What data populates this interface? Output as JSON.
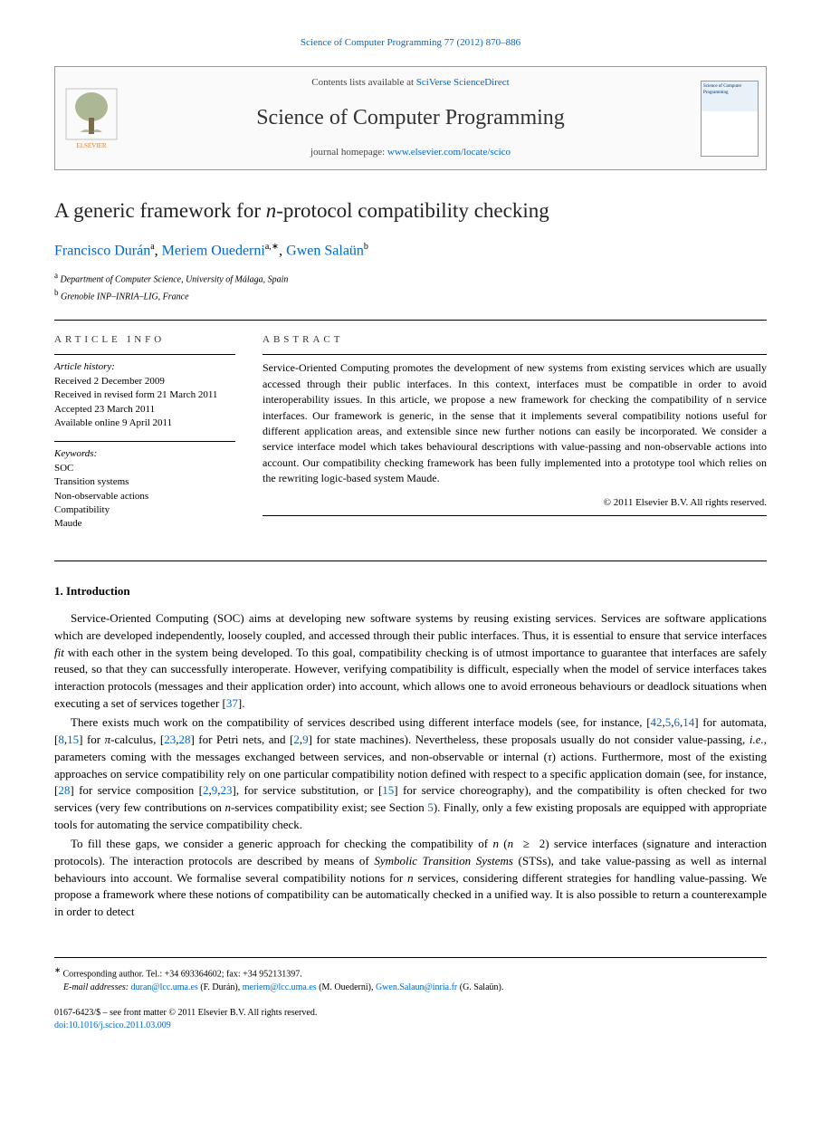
{
  "citation": "Science of Computer Programming 77 (2012) 870–886",
  "contents_text": "Contents lists available at ",
  "contents_link": "SciVerse ScienceDirect",
  "journal_name": "Science of Computer Programming",
  "homepage_text": "journal homepage: ",
  "homepage_link": "www.elsevier.com/locate/scico",
  "cover_text": "Science of Computer Programming",
  "title_plain": "A generic framework for n-protocol compatibility checking",
  "authors": [
    {
      "name": "Francisco Durán",
      "affil": "a"
    },
    {
      "name": "Meriem Ouederni",
      "affil": "a,∗"
    },
    {
      "name": "Gwen Salaün",
      "affil": "b"
    }
  ],
  "affiliations": [
    {
      "label": "a",
      "text": "Department of Computer Science, University of Málaga, Spain"
    },
    {
      "label": "b",
      "text": "Grenoble INP–INRIA–LIG, France"
    }
  ],
  "info_heading": "ARTICLE INFO",
  "abstract_heading": "ABSTRACT",
  "history_label": "Article history:",
  "history": [
    "Received 2 December 2009",
    "Received in revised form 21 March 2011",
    "Accepted 23 March 2011",
    "Available online 9 April 2011"
  ],
  "keywords_label": "Keywords:",
  "keywords": [
    "SOC",
    "Transition systems",
    "Non-observable actions",
    "Compatibility",
    "Maude"
  ],
  "abstract": "Service-Oriented Computing promotes the development of new systems from existing services which are usually accessed through their public interfaces. In this context, interfaces must be compatible in order to avoid interoperability issues. In this article, we propose a new framework for checking the compatibility of n service interfaces. Our framework is generic, in the sense that it implements several compatibility notions useful for different application areas, and extensible since new further notions can easily be incorporated. We consider a service interface model which takes behavioural descriptions with value-passing and non-observable actions into account. Our compatibility checking framework has been fully implemented into a prototype tool which relies on the rewriting logic-based system Maude.",
  "copyright": "© 2011 Elsevier B.V. All rights reserved.",
  "section1": "1.  Introduction",
  "para1": "Service-Oriented Computing (SOC) aims at developing new software systems by reusing existing services. Services are software applications which are developed independently, loosely coupled, and accessed through their public interfaces. Thus, it is essential to ensure that service interfaces fit with each other in the system being developed. To this goal, compatibility checking is of utmost importance to guarantee that interfaces are safely reused, so that they can successfully interoperate. However, verifying compatibility is difficult, especially when the model of service interfaces takes interaction protocols (messages and their application order) into account, which allows one to avoid erroneous behaviours or deadlock situations when executing a set of services together [37].",
  "para2": "There exists much work on the compatibility of services described using different interface models (see, for instance, [42,5,6,14] for automata, [8,15] for π-calculus, [23,28] for Petri nets, and [2,9] for state machines). Nevertheless, these proposals usually do not consider value-passing, i.e., parameters coming with the messages exchanged between services, and non-observable or internal (τ) actions. Furthermore, most of the existing approaches on service compatibility rely on one particular compatibility notion defined with respect to a specific application domain (see, for instance, [28] for service composition [2,9,23], for service substitution, or [15] for service choreography), and the compatibility is often checked for two services (very few contributions on n-services compatibility exist; see Section 5). Finally, only a few existing proposals are equipped with appropriate tools for automating the service compatibility check.",
  "para3": "To fill these gaps, we consider a generic approach for checking the compatibility of n (n ≥ 2) service interfaces (signature and interaction protocols). The interaction protocols are described by means of Symbolic Transition Systems (STSs), and take value-passing as well as internal behaviours into account. We formalise several compatibility notions for n services, considering different strategies for handling value-passing. We propose a framework where these notions of compatibility can be automatically checked in a unified way. It is also possible to return a counterexample in order to detect",
  "footer": {
    "corr_label": "∗",
    "corr_text": "Corresponding author. Tel.: +34 693364602; fax: +34 952131397.",
    "email_label": "E-mail addresses:",
    "emails": [
      {
        "addr": "duran@lcc.uma.es",
        "who": "(F. Durán)"
      },
      {
        "addr": "meriem@lcc.uma.es",
        "who": "(M. Ouederni)"
      },
      {
        "addr": "Gwen.Salaun@inria.fr",
        "who": "(G. Salaün)"
      }
    ],
    "issn": "0167-6423/$ – see front matter © 2011 Elsevier B.V. All rights reserved.",
    "doi_label": "doi:",
    "doi": "10.1016/j.scico.2011.03.009"
  }
}
